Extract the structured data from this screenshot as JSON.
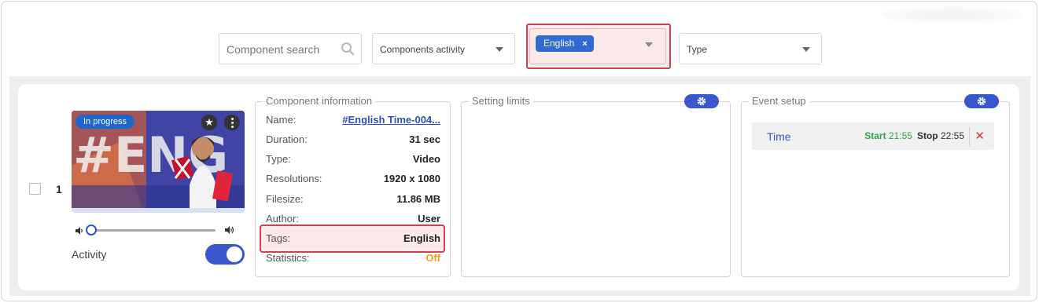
{
  "filters": {
    "search_placeholder": "Component search",
    "activity_label": "Components activity",
    "tag_chip": "English",
    "tag_chip_remove": "×",
    "type_label": "Type"
  },
  "component": {
    "row_number": "1",
    "status_badge": "In progress",
    "star_glyph": "★",
    "volume_percent": 0,
    "activity_label": "Activity",
    "activity_enabled": true
  },
  "info": {
    "title": "Component information",
    "rows": [
      {
        "key": "Name:",
        "value": "#English Time-004..."
      },
      {
        "key": "Duration:",
        "value": "31 sec"
      },
      {
        "key": "Type:",
        "value": "Video"
      },
      {
        "key": "Resolutions:",
        "value": "1920 x 1080"
      },
      {
        "key": "Filesize:",
        "value": "11.86 MB"
      },
      {
        "key": "Author:",
        "value": "User"
      },
      {
        "key": "Tags:",
        "value": "English"
      },
      {
        "key": "Statistics:",
        "value": "Off"
      }
    ]
  },
  "limits": {
    "title": "Setting limits"
  },
  "events": {
    "title": "Event setup",
    "items": [
      {
        "name": "Time",
        "start_label": "Start",
        "start_value": "21:55",
        "stop_label": "Stop",
        "stop_value": "22:55",
        "remove_glyph": "✕"
      }
    ]
  },
  "colors": {
    "accent": "#3a56cf",
    "chip": "#2f6bd3",
    "highlight_border": "#c9444e",
    "start_green": "#28a745",
    "off_orange": "#e8a21a"
  }
}
